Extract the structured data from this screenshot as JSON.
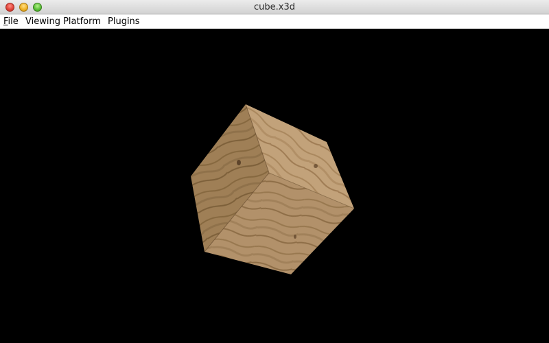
{
  "window": {
    "title": "cube.x3d"
  },
  "menubar": {
    "items": [
      {
        "label_mnemonic": "F",
        "label_rest": "ile"
      },
      {
        "label": "Viewing Platform"
      },
      {
        "label": "Plugins"
      }
    ]
  },
  "scene": {
    "background_color": "#000000",
    "object": "textured-cube",
    "texture": "wood"
  }
}
